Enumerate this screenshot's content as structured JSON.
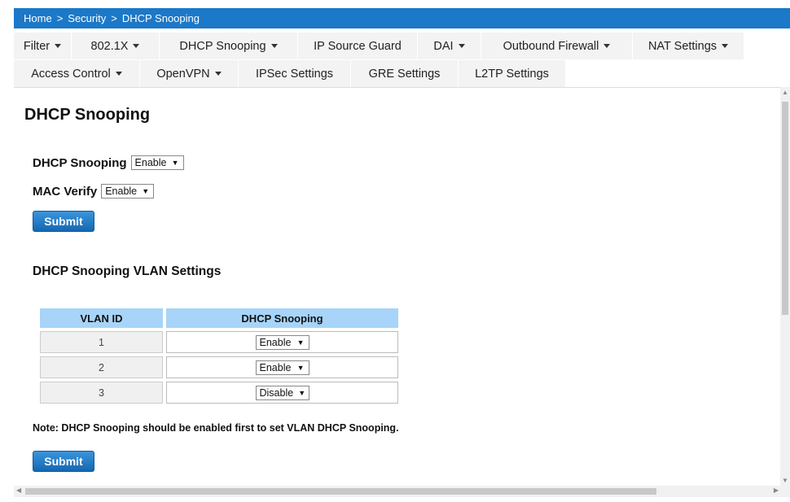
{
  "breadcrumb": [
    "Home",
    "Security",
    "DHCP Snooping"
  ],
  "breadcrumb_separator": ">",
  "tabs": {
    "row1": [
      {
        "label": "Filter",
        "dropdown": true
      },
      {
        "label": "802.1X",
        "dropdown": true
      },
      {
        "label": "DHCP Snooping",
        "dropdown": true
      },
      {
        "label": "IP Source Guard",
        "dropdown": false
      },
      {
        "label": "DAI",
        "dropdown": true
      },
      {
        "label": "Outbound Firewall",
        "dropdown": true
      },
      {
        "label": "NAT Settings",
        "dropdown": true
      }
    ],
    "row2": [
      {
        "label": "Access Control",
        "dropdown": true
      },
      {
        "label": "OpenVPN",
        "dropdown": true
      },
      {
        "label": "IPSec Settings",
        "dropdown": false
      },
      {
        "label": "GRE Settings",
        "dropdown": false
      },
      {
        "label": "L2TP Settings",
        "dropdown": false
      }
    ]
  },
  "page_title": "DHCP Snooping",
  "global_settings": {
    "dhcp_snooping_label": "DHCP Snooping",
    "dhcp_snooping_value": "Enable",
    "mac_verify_label": "MAC Verify",
    "mac_verify_value": "Enable",
    "submit_label": "Submit"
  },
  "vlan_section": {
    "title": "DHCP Snooping VLAN Settings",
    "columns": [
      "VLAN ID",
      "DHCP Snooping"
    ],
    "rows": [
      {
        "vlan_id": "1",
        "snooping": "Enable"
      },
      {
        "vlan_id": "2",
        "snooping": "Enable"
      },
      {
        "vlan_id": "3",
        "snooping": "Disable"
      }
    ],
    "note": "Note: DHCP Snooping should be enabled first to set VLAN DHCP Snooping.",
    "submit_label": "Submit"
  },
  "colors": {
    "breadcrumb_bg": "#1c78c8",
    "table_header_bg": "#a7d4f8",
    "button_blue": "#1567b0"
  }
}
